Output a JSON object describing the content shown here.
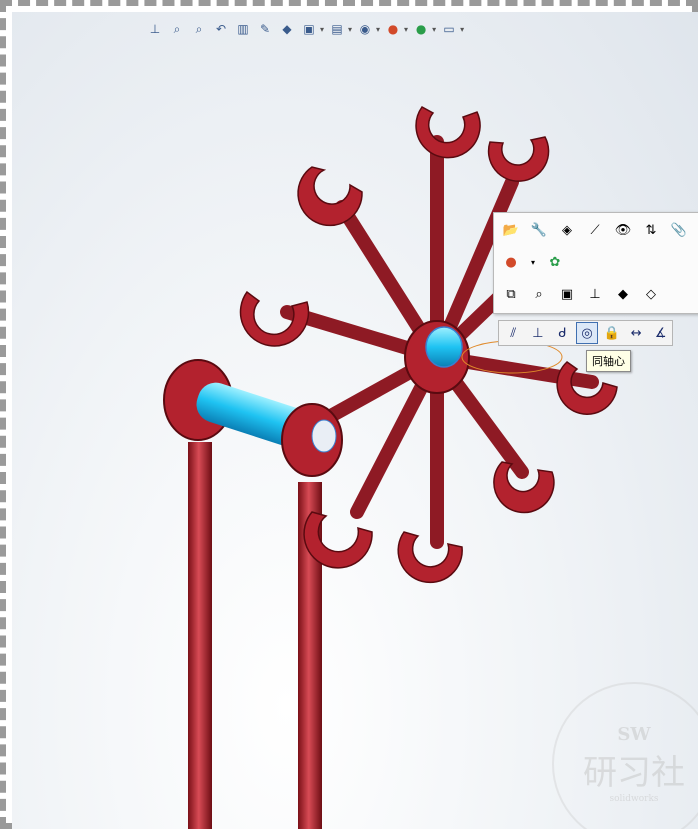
{
  "top_toolbar": {
    "icons": [
      "view-normal-icon",
      "zoom-to-fit-icon",
      "zoom-area-icon",
      "previous-view-icon",
      "section-view-icon",
      "dynamic-annotation-icon",
      "view-orientation-icon",
      "display-style-icon",
      "hide-show-icon",
      "edit-appearance-icon",
      "apply-scene-icon",
      "view-settings-icon"
    ]
  },
  "context_toolbar": {
    "row1": [
      "open-part-icon",
      "rebuild-icon",
      "component-properties-icon",
      "hide-icon",
      "isolate-icon",
      "change-transparency-icon",
      "paperclip-icon"
    ],
    "row2": [
      "appearance-icon",
      "appearance-caret-icon",
      "apply-scene-icon"
    ],
    "row3": [
      "select-other-icon",
      "zoom-to-selection-icon",
      "normal-to-icon",
      "mate-icon",
      "view-orientation-icon",
      "reference-icon"
    ]
  },
  "mate_toolbar": {
    "buttons": [
      {
        "name": "parallel-mate-icon",
        "glyph": "⫽"
      },
      {
        "name": "perpendicular-mate-icon",
        "glyph": "⊥"
      },
      {
        "name": "tangent-mate-icon",
        "glyph": "ᑯ"
      },
      {
        "name": "concentric-mate-icon",
        "glyph": "◎",
        "active": true
      },
      {
        "name": "lock-mate-icon",
        "glyph": "🔒"
      },
      {
        "name": "distance-mate-icon",
        "glyph": "↔"
      },
      {
        "name": "angle-mate-icon",
        "glyph": "∡"
      }
    ]
  },
  "tooltip": {
    "text": "同轴心"
  },
  "watermark": {
    "top": "SW",
    "main": "研习社",
    "sub": "solidworks"
  },
  "colors": {
    "part_red": "#b3222e",
    "highlight_cyan": "#29c6f4",
    "background": "#eef2f6"
  }
}
